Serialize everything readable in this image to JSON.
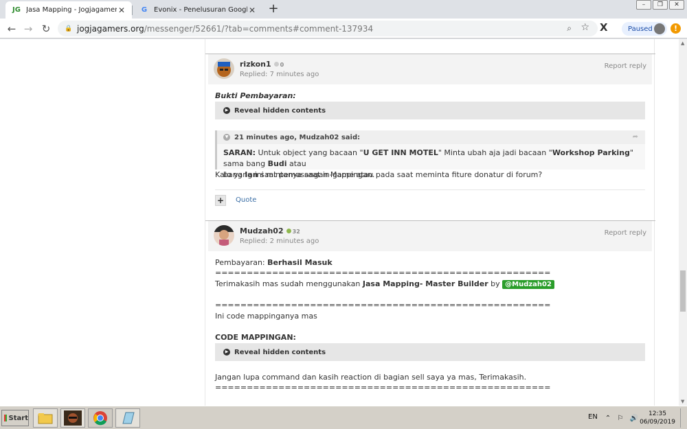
{
  "browser": {
    "tabs": [
      {
        "favicon": "JG",
        "title": "Jasa Mapping - Jogjagamers Comm",
        "active": true
      },
      {
        "favicon": "G",
        "title": "Evonix - Penelusuran Google",
        "active": false
      }
    ],
    "url_host": "jogjagamers.org",
    "url_path": "/messenger/52661/?tab=comments#comment-137934",
    "profile_status": "Paused"
  },
  "comments": [
    {
      "author": "rizkon1",
      "reputation": "0",
      "replied": "Replied: 7 minutes ago",
      "report": "Report reply",
      "proof_label": "Bukti Pembayaran:",
      "reveal": "Reveal hidden contents",
      "quote": {
        "header": "21 minutes ago, Mudzah02 said:",
        "saran_label": "SARAN:",
        "t1": " Untuk object yang bacaan \"",
        "b1": "U GET INN MOTEL",
        "t2": "\" Minta ubah aja jadi bacaan \"",
        "b2": "Workshop Parking",
        "t3": "\" sama bang ",
        "b3": "Budi",
        "t4": " atau",
        "t5": "bang ",
        "b4": "Ian",
        "t6": " saat pemasangan Mappingan."
      },
      "body": "Kalo yang ini mintanya saat in-game atau pada saat meminta fiture donatur di forum?",
      "quote_action": "Quote"
    },
    {
      "author": "Mudzah02",
      "reputation": "32",
      "replied": "Replied: 2 minutes ago",
      "report": "Report reply",
      "payment_label": "Pembayaran: ",
      "payment_status": "Berhasil Masuk",
      "divider": "=====================================================",
      "thanks_prefix": "Terimakasih mas sudah menggunakan ",
      "service_name": "Jasa Mapping- Master Builder",
      "by": " by ",
      "mention": "@Mudzah02",
      "code_intro": "Ini code mappinganya mas",
      "code_label": "CODE MAPPINGAN:",
      "reveal": "Reveal hidden contents",
      "closing": "Jangan lupa command dan kasih reaction di bagian sell saya ya mas, Terimakasih."
    }
  ],
  "taskbar": {
    "start": "Start",
    "lang": "EN",
    "time": "12:35",
    "date": "06/09/2019"
  },
  "colors": {
    "mention_bg": "#2a9d2a",
    "link": "#3a6ea5"
  }
}
